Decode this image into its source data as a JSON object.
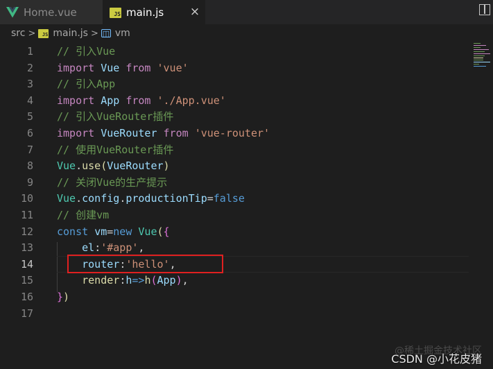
{
  "tabs": [
    {
      "label": "Home.vue",
      "icon": "vue-icon",
      "active": false
    },
    {
      "label": "main.js",
      "icon": "js-icon",
      "active": true,
      "close": "×"
    }
  ],
  "breadcrumb": {
    "folder": "src",
    "file": "main.js",
    "symbol": "vm",
    "separator": ">"
  },
  "editor": {
    "current_line": 14,
    "highlight_color": "#e02020",
    "lines": [
      {
        "n": "1",
        "tokens": [
          {
            "t": "// 引入Vue",
            "c": "c-cmt"
          }
        ]
      },
      {
        "n": "2",
        "tokens": [
          {
            "t": "import",
            "c": "c-kw"
          },
          {
            "t": " ",
            "c": "c-pun"
          },
          {
            "t": "Vue",
            "c": "c-var"
          },
          {
            "t": " ",
            "c": "c-pun"
          },
          {
            "t": "from",
            "c": "c-kw"
          },
          {
            "t": " ",
            "c": "c-pun"
          },
          {
            "t": "'vue'",
            "c": "c-str"
          }
        ]
      },
      {
        "n": "3",
        "tokens": [
          {
            "t": "// 引入App",
            "c": "c-cmt"
          }
        ]
      },
      {
        "n": "4",
        "tokens": [
          {
            "t": "import",
            "c": "c-kw"
          },
          {
            "t": " ",
            "c": "c-pun"
          },
          {
            "t": "App",
            "c": "c-var"
          },
          {
            "t": " ",
            "c": "c-pun"
          },
          {
            "t": "from",
            "c": "c-kw"
          },
          {
            "t": " ",
            "c": "c-pun"
          },
          {
            "t": "'./App.vue'",
            "c": "c-str"
          }
        ]
      },
      {
        "n": "5",
        "tokens": [
          {
            "t": "// 引入VueRouter插件",
            "c": "c-cmt"
          }
        ]
      },
      {
        "n": "6",
        "tokens": [
          {
            "t": "import",
            "c": "c-kw"
          },
          {
            "t": " ",
            "c": "c-pun"
          },
          {
            "t": "VueRouter",
            "c": "c-var"
          },
          {
            "t": " ",
            "c": "c-pun"
          },
          {
            "t": "from",
            "c": "c-kw"
          },
          {
            "t": " ",
            "c": "c-pun"
          },
          {
            "t": "'vue-router'",
            "c": "c-str"
          }
        ]
      },
      {
        "n": "7",
        "tokens": [
          {
            "t": "// 使用VueRouter插件",
            "c": "c-cmt"
          }
        ]
      },
      {
        "n": "8",
        "tokens": [
          {
            "t": "Vue",
            "c": "c-cls"
          },
          {
            "t": ".",
            "c": "c-pun"
          },
          {
            "t": "use",
            "c": "c-fn"
          },
          {
            "t": "(",
            "c": "c-fn"
          },
          {
            "t": "VueRouter",
            "c": "c-var"
          },
          {
            "t": ")",
            "c": "c-fn"
          }
        ]
      },
      {
        "n": "9",
        "tokens": [
          {
            "t": "// 关闭Vue的生产提示",
            "c": "c-cmt"
          }
        ]
      },
      {
        "n": "10",
        "tokens": [
          {
            "t": "Vue",
            "c": "c-cls"
          },
          {
            "t": ".",
            "c": "c-pun"
          },
          {
            "t": "config",
            "c": "c-var"
          },
          {
            "t": ".",
            "c": "c-pun"
          },
          {
            "t": "productionTip",
            "c": "c-var"
          },
          {
            "t": "=",
            "c": "c-pun"
          },
          {
            "t": "false",
            "c": "c-kw2"
          }
        ]
      },
      {
        "n": "11",
        "tokens": [
          {
            "t": "// 创建vm",
            "c": "c-cmt"
          }
        ]
      },
      {
        "n": "12",
        "tokens": [
          {
            "t": "const",
            "c": "c-kw2"
          },
          {
            "t": " ",
            "c": "c-pun"
          },
          {
            "t": "vm",
            "c": "c-var"
          },
          {
            "t": "=",
            "c": "c-pun"
          },
          {
            "t": "new",
            "c": "c-kw2"
          },
          {
            "t": " ",
            "c": "c-pun"
          },
          {
            "t": "Vue",
            "c": "c-cls"
          },
          {
            "t": "(",
            "c": "c-fn"
          },
          {
            "t": "{",
            "c": "c-br"
          }
        ]
      },
      {
        "n": "13",
        "tokens": [
          {
            "t": "    ",
            "c": "c-pun"
          },
          {
            "t": "el",
            "c": "c-var"
          },
          {
            "t": ":",
            "c": "c-pun"
          },
          {
            "t": "'#app'",
            "c": "c-str"
          },
          {
            "t": ",",
            "c": "c-pun"
          }
        ]
      },
      {
        "n": "14",
        "tokens": [
          {
            "t": "    ",
            "c": "c-pun"
          },
          {
            "t": "router",
            "c": "c-var"
          },
          {
            "t": ":",
            "c": "c-pun"
          },
          {
            "t": "'hello'",
            "c": "c-str"
          },
          {
            "t": ",",
            "c": "c-pun"
          }
        ]
      },
      {
        "n": "15",
        "tokens": [
          {
            "t": "    ",
            "c": "c-pun"
          },
          {
            "t": "render",
            "c": "c-fn"
          },
          {
            "t": ":",
            "c": "c-pun"
          },
          {
            "t": "h",
            "c": "c-var"
          },
          {
            "t": "=>",
            "c": "c-kw2"
          },
          {
            "t": "h",
            "c": "c-fn"
          },
          {
            "t": "(",
            "c": "c-br"
          },
          {
            "t": "App",
            "c": "c-var"
          },
          {
            "t": ")",
            "c": "c-br"
          },
          {
            "t": ",",
            "c": "c-pun"
          }
        ]
      },
      {
        "n": "16",
        "tokens": [
          {
            "t": "}",
            "c": "c-br"
          },
          {
            "t": ")",
            "c": "c-fn"
          }
        ]
      },
      {
        "n": "17",
        "tokens": []
      }
    ]
  },
  "watermark": {
    "back": "@稀土掘金技术社区",
    "front": "CSDN @小花皮猪"
  }
}
